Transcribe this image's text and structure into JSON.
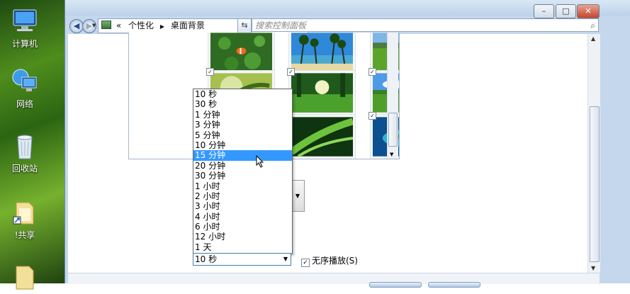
{
  "desktop": {
    "icons": [
      {
        "label": "计算机",
        "icon": "computer-icon"
      },
      {
        "label": "网络",
        "icon": "network-icon"
      },
      {
        "label": "回收站",
        "icon": "recycle-bin-icon"
      },
      {
        "label": "!共享",
        "icon": "shared-folder-icon"
      }
    ]
  },
  "window": {
    "caption_buttons": {
      "minimize": "–",
      "maximize": "□",
      "close": "✕"
    },
    "breadcrumb": [
      "个性化",
      "桌面背景"
    ],
    "breadcrumb_prefix": "«",
    "search_placeholder": "搜索控制面板",
    "accent": "#3399ff"
  },
  "slideshow": {
    "interval_options": [
      "10 秒",
      "30 秒",
      "1 分钟",
      "3 分钟",
      "5 分钟",
      "10 分钟",
      "15 分钟",
      "20 分钟",
      "30 分钟",
      "1 小时",
      "2 小时",
      "3 小时",
      "4 小时",
      "6 小时",
      "12 小时",
      "1 天"
    ],
    "highlighted_option": "15 分钟",
    "selected_value": "10 秒",
    "shuffle_label": "无序播放(S)",
    "shuffle_checked": true
  },
  "wallpapers": [
    {
      "name": "clownfish",
      "checked": false
    },
    {
      "name": "palm-beach",
      "checked": false
    },
    {
      "name": "green-field",
      "checked": false
    },
    {
      "name": "leaf-bokeh",
      "checked": true
    },
    {
      "name": "sunlit-forest",
      "checked": true
    },
    {
      "name": "green-meadow",
      "checked": true
    },
    {
      "name": "dew-leaf",
      "checked": true
    },
    {
      "name": "blue-lagoon",
      "checked": true
    }
  ]
}
